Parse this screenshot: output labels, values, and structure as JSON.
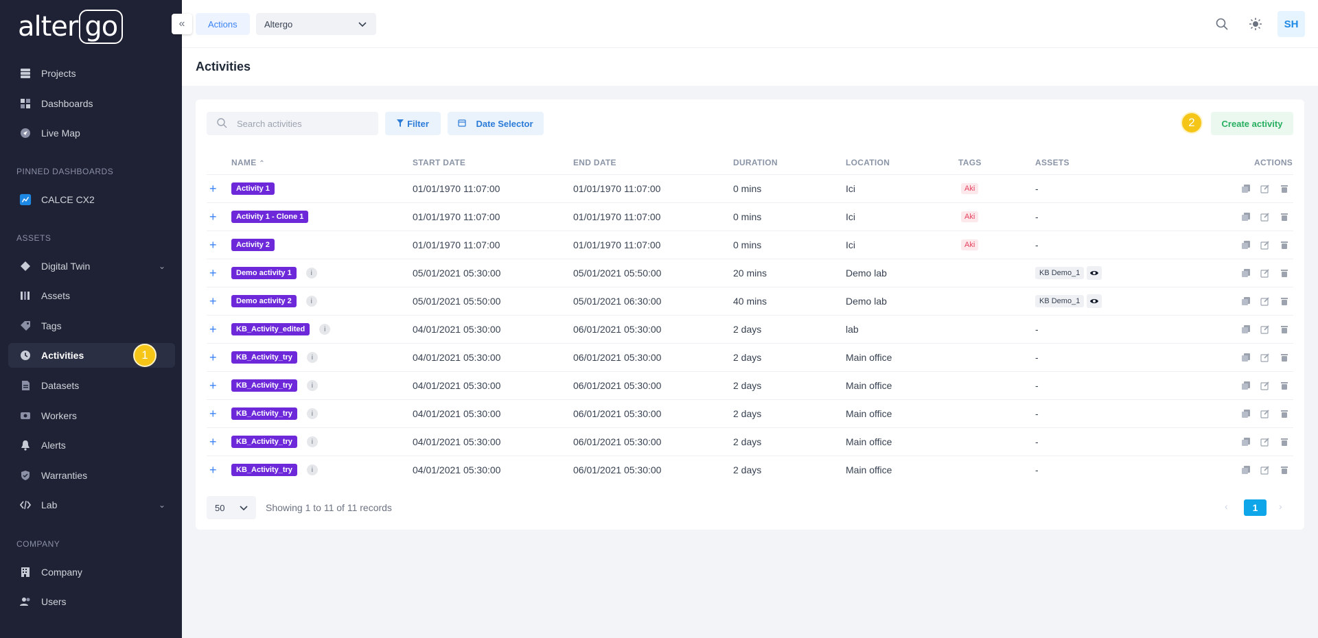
{
  "sidebar": {
    "logo_main": "alter",
    "logo_box": "go",
    "collapse_icon": "«",
    "items_top": [
      {
        "label": "Projects",
        "icon": "projects-icon"
      },
      {
        "label": "Dashboards",
        "icon": "dashboards-icon"
      },
      {
        "label": "Live Map",
        "icon": "live-map-icon"
      }
    ],
    "pinned_label": "PINNED DASHBOARDS",
    "pinned_item": "CALCE CX2",
    "assets_label": "ASSETS",
    "asset_items": [
      {
        "label": "Digital Twin"
      },
      {
        "label": "Assets"
      },
      {
        "label": "Tags"
      },
      {
        "label": "Activities"
      },
      {
        "label": "Datasets"
      },
      {
        "label": "Workers"
      },
      {
        "label": "Alerts"
      },
      {
        "label": "Warranties"
      },
      {
        "label": "Lab"
      }
    ],
    "company_label": "COMPANY",
    "company_items": [
      {
        "label": "Company"
      },
      {
        "label": "Users"
      }
    ],
    "step_badge": "1"
  },
  "header": {
    "actions_tab": "Actions",
    "org_select": "Altergo",
    "avatar": "SH"
  },
  "page": {
    "title": "Activities"
  },
  "toolbar": {
    "search_placeholder": "Search activities",
    "filter_label": "Filter",
    "date_selector_label": "Date Selector",
    "step_badge": "2",
    "create_label": "Create activity"
  },
  "table": {
    "headers": [
      "NAME",
      "START DATE",
      "END DATE",
      "DURATION",
      "LOCATION",
      "TAGS",
      "ASSETS",
      "ACTIONS"
    ],
    "sort_indicator": "^",
    "rows": [
      {
        "name": "Activity 1",
        "start": "01/01/1970 11:07:00",
        "end": "01/01/1970 11:07:00",
        "duration": "0 mins",
        "location": "Ici",
        "tag": "Aki",
        "asset": "-"
      },
      {
        "name": "Activity 1 - Clone 1",
        "start": "01/01/1970 11:07:00",
        "end": "01/01/1970 11:07:00",
        "duration": "0 mins",
        "location": "Ici",
        "tag": "Aki",
        "asset": "-"
      },
      {
        "name": "Activity 2",
        "start": "01/01/1970 11:07:00",
        "end": "01/01/1970 11:07:00",
        "duration": "0 mins",
        "location": "Ici",
        "tag": "Aki",
        "asset": "-"
      },
      {
        "name": "Demo activity 1",
        "start": "05/01/2021 05:30:00",
        "end": "05/01/2021 05:50:00",
        "duration": "20 mins",
        "location": "Demo lab",
        "tag": "",
        "asset": "KB Demo_1"
      },
      {
        "name": "Demo activity 2",
        "start": "05/01/2021 05:50:00",
        "end": "05/01/2021 06:30:00",
        "duration": "40 mins",
        "location": "Demo lab",
        "tag": "",
        "asset": "KB Demo_1"
      },
      {
        "name": "KB_Activity_edited",
        "start": "04/01/2021 05:30:00",
        "end": "06/01/2021 05:30:00",
        "duration": "2 days",
        "location": "lab",
        "tag": "",
        "asset": "-"
      },
      {
        "name": "KB_Activity_try",
        "start": "04/01/2021 05:30:00",
        "end": "06/01/2021 05:30:00",
        "duration": "2 days",
        "location": "Main office",
        "tag": "",
        "asset": "-"
      },
      {
        "name": "KB_Activity_try",
        "start": "04/01/2021 05:30:00",
        "end": "06/01/2021 05:30:00",
        "duration": "2 days",
        "location": "Main office",
        "tag": "",
        "asset": "-"
      },
      {
        "name": "KB_Activity_try",
        "start": "04/01/2021 05:30:00",
        "end": "06/01/2021 05:30:00",
        "duration": "2 days",
        "location": "Main office",
        "tag": "",
        "asset": "-"
      },
      {
        "name": "KB_Activity_try",
        "start": "04/01/2021 05:30:00",
        "end": "06/01/2021 05:30:00",
        "duration": "2 days",
        "location": "Main office",
        "tag": "",
        "asset": "-"
      },
      {
        "name": "KB_Activity_try",
        "start": "04/01/2021 05:30:00",
        "end": "06/01/2021 05:30:00",
        "duration": "2 days",
        "location": "Main office",
        "tag": "",
        "asset": "-"
      }
    ]
  },
  "pagination": {
    "page_size": "50",
    "records_text": "Showing 1 to 11 of 11 records",
    "current_page": "1"
  }
}
